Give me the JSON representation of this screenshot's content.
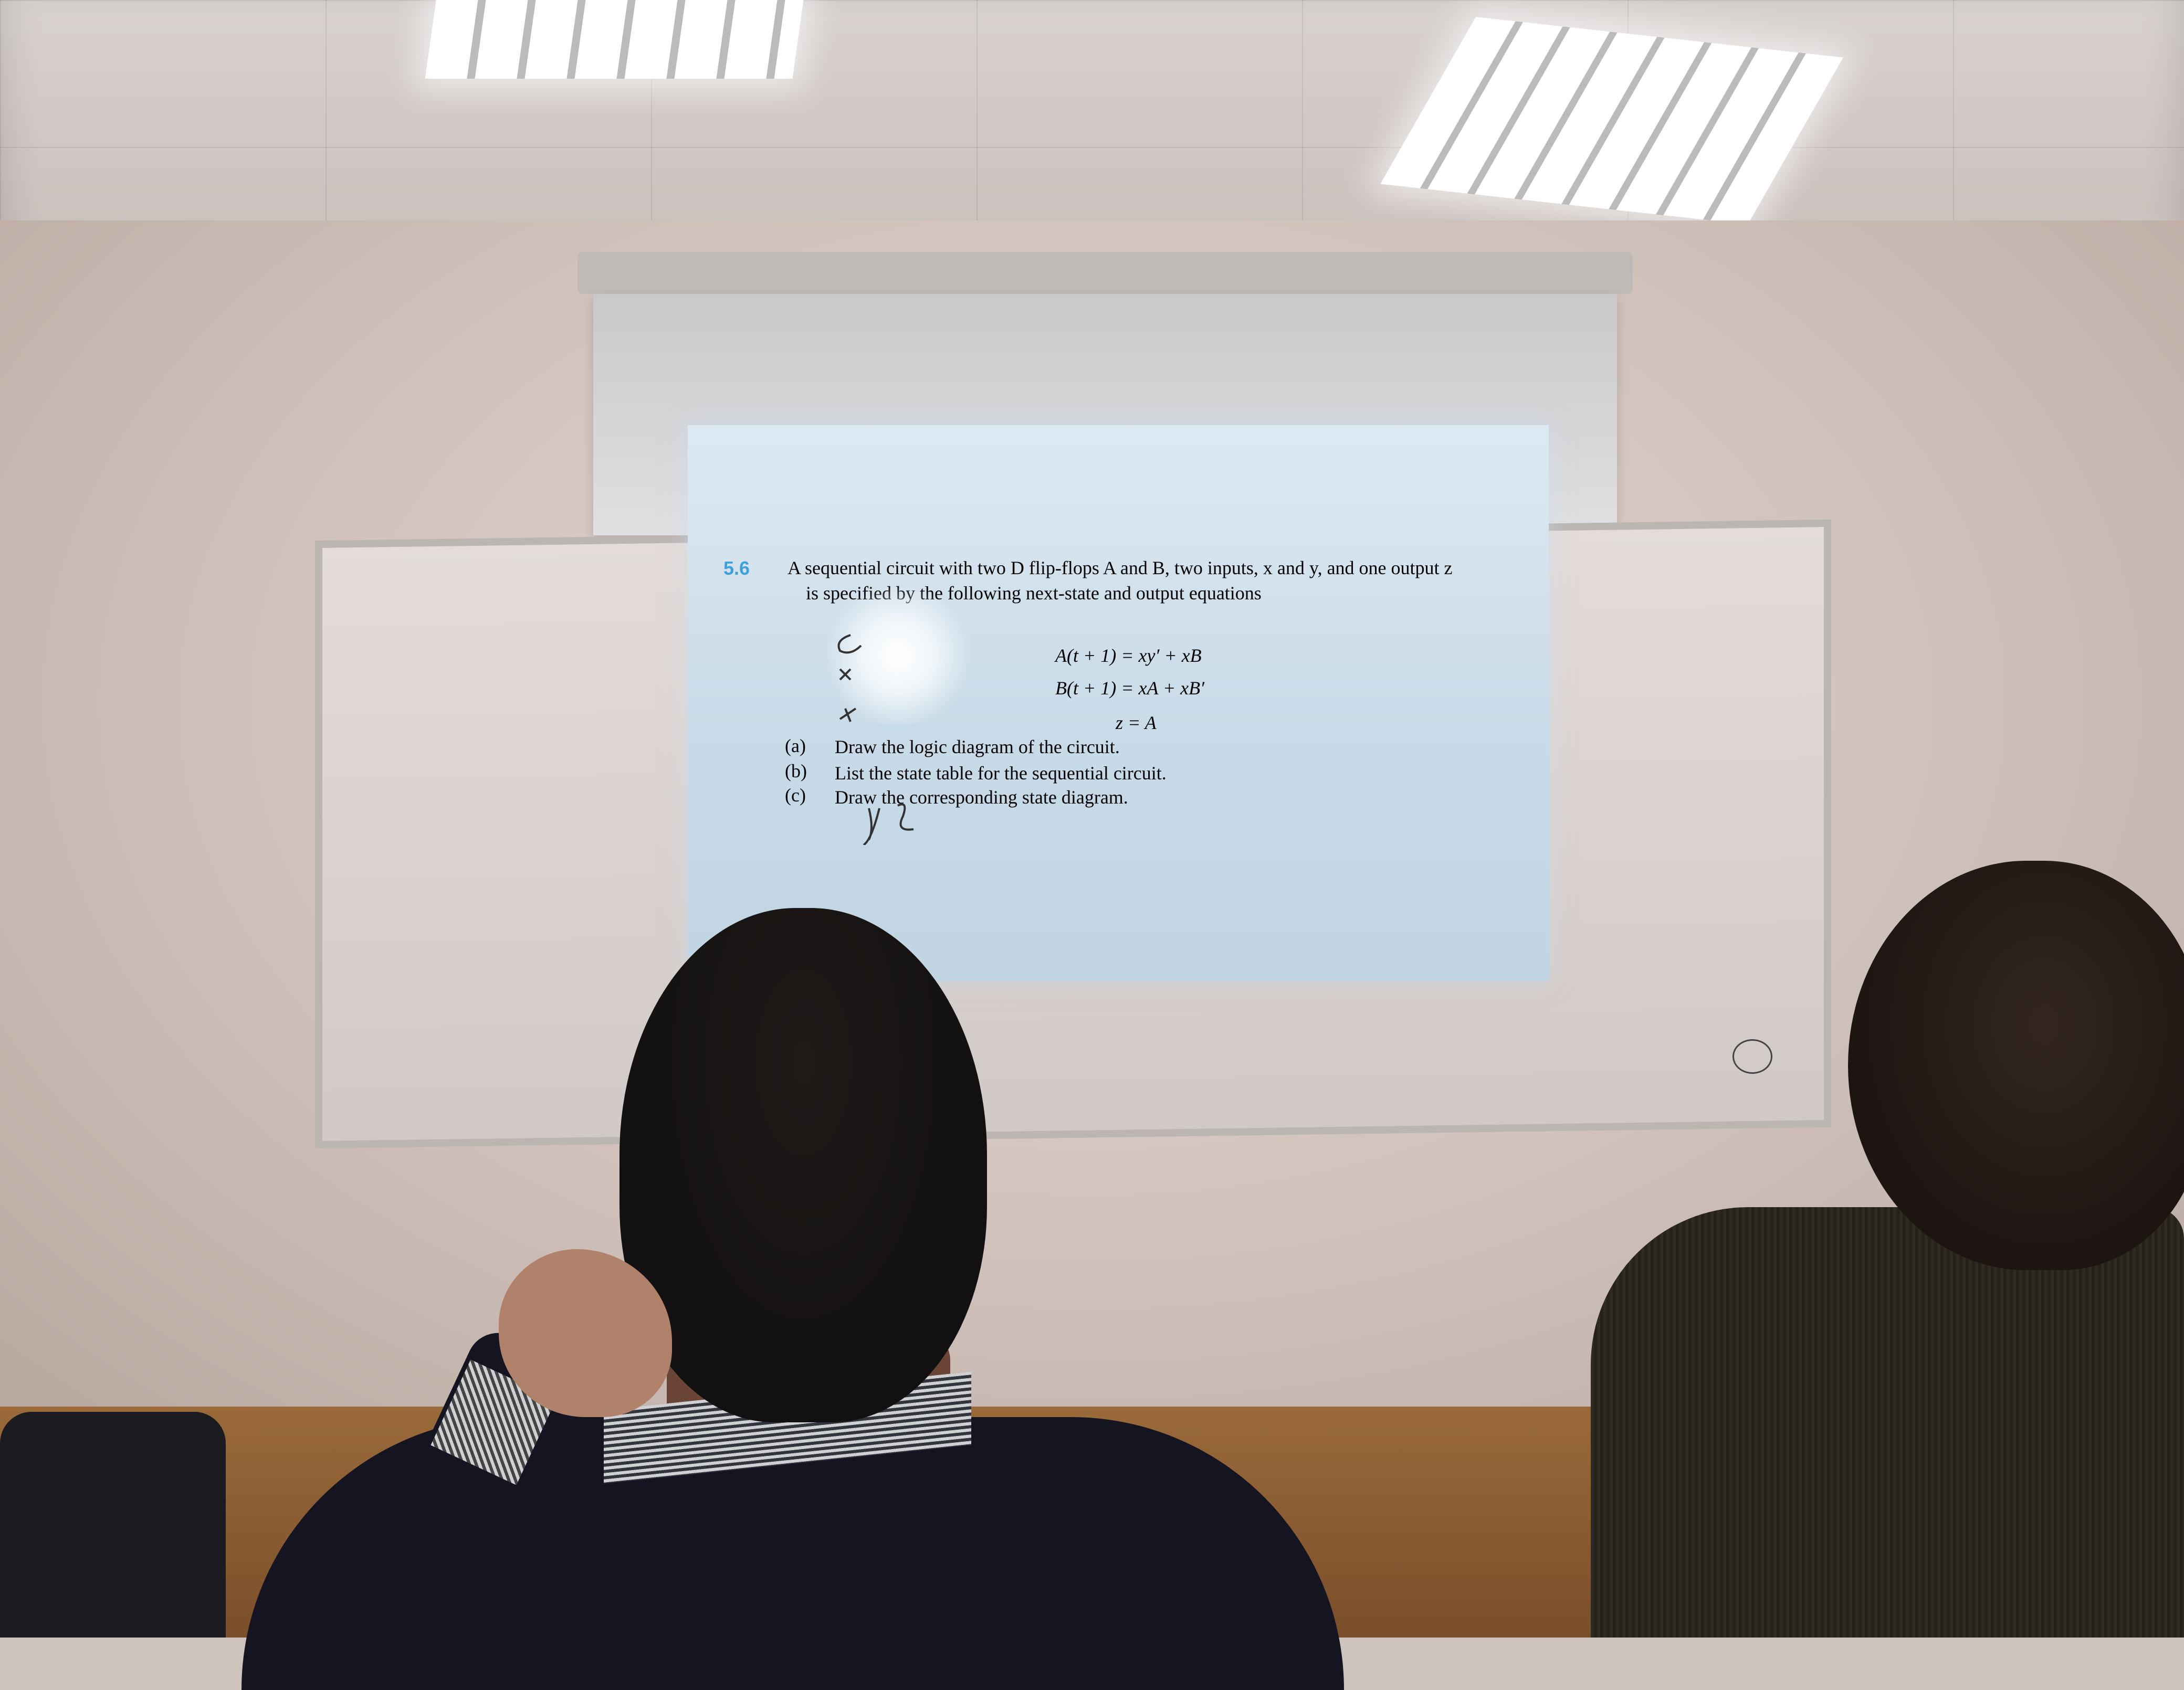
{
  "slide": {
    "problem_number": "5.6",
    "line1": "A sequential circuit with two D flip-flops A and B, two inputs, x and y, and one output z",
    "line2": "is specified by the following next-state and output equations",
    "equations": {
      "eq1": "A(t + 1) = xy′ + xB",
      "eq2": "B(t + 1) = xA + xB′",
      "eq3": "z = A"
    },
    "parts": [
      {
        "label": "(a)",
        "text": "Draw the logic diagram of the circuit."
      },
      {
        "label": "(b)",
        "text": "List the state table for the sequential circuit."
      },
      {
        "label": "(c)",
        "text": "Draw the corresponding state diagram."
      }
    ]
  },
  "colors": {
    "problem_number": "#3ea0d8",
    "slide_background": "#c8dbe8",
    "slide_text": "#2a3140"
  }
}
